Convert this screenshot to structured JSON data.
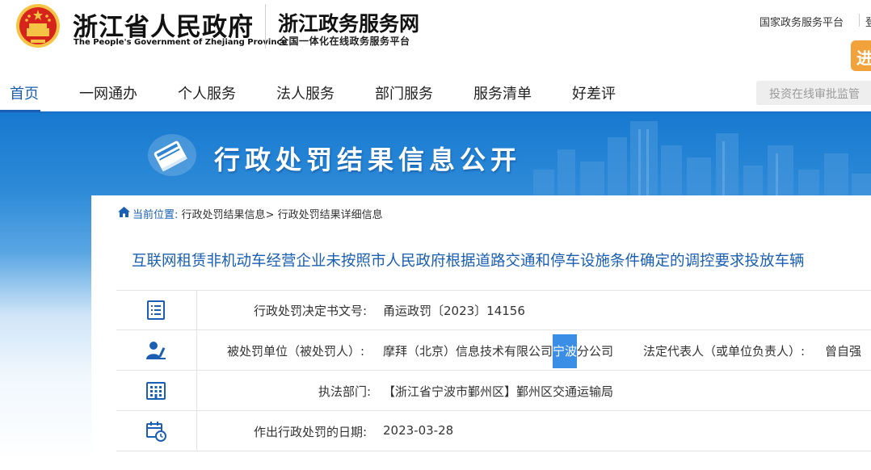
{
  "header": {
    "brand_cn": "浙江省人民政府",
    "brand_en": "The People's Government of Zhejiang Province",
    "site_title": "浙江政务服务网",
    "site_subtitle": "全国一体化在线政务服务平台",
    "top_link": "国家政务服务平台",
    "top_link_2": "登",
    "enter_button": "进"
  },
  "nav": {
    "items": [
      "首页",
      "一网通办",
      "个人服务",
      "法人服务",
      "部门服务",
      "服务清单",
      "好差评"
    ],
    "active": "首页",
    "search_placeholder": "投资在线审批监管"
  },
  "banner": {
    "title": "行政处罚结果信息公开"
  },
  "breadcrumb": {
    "label": "当前位置:",
    "items": [
      "行政处罚结果信息",
      "行政处罚结果详细信息"
    ],
    "separator": ">"
  },
  "document": {
    "title": "互联网租赁非机动车经营企业未按照市人民政府根据道路交通和停车设施条件确定的调控要求投放车辆",
    "fields": {
      "decision_no_label": "行政处罚决定书文号:",
      "decision_no_value": "甬运政罚〔2023〕14156",
      "party_label": "被处罚单位（被处罚人）:",
      "party_value_pre": "摩拜（北京）信息技术有限公司",
      "party_value_hl": "宁波",
      "party_value_post": "分公司",
      "legal_rep_label": "法定代表人（或单位负责人）:",
      "legal_rep_value": "曾自强",
      "dept_label": "执法部门:",
      "dept_value": "【浙江省宁波市鄞州区】鄞州区交通运输局",
      "date_label": "作出行政处罚的日期:",
      "date_value": "2023-03-28"
    }
  },
  "colors": {
    "primary_blue": "#1a5fb4",
    "banner_blue": "#1779cf",
    "enter_orange": "#f2a23a",
    "highlight": "#3b8ee6"
  },
  "icons": [
    "emblem-icon",
    "book-icon",
    "home-icon",
    "document-list-icon",
    "person-icon",
    "building-icon",
    "calendar-clock-icon"
  ]
}
